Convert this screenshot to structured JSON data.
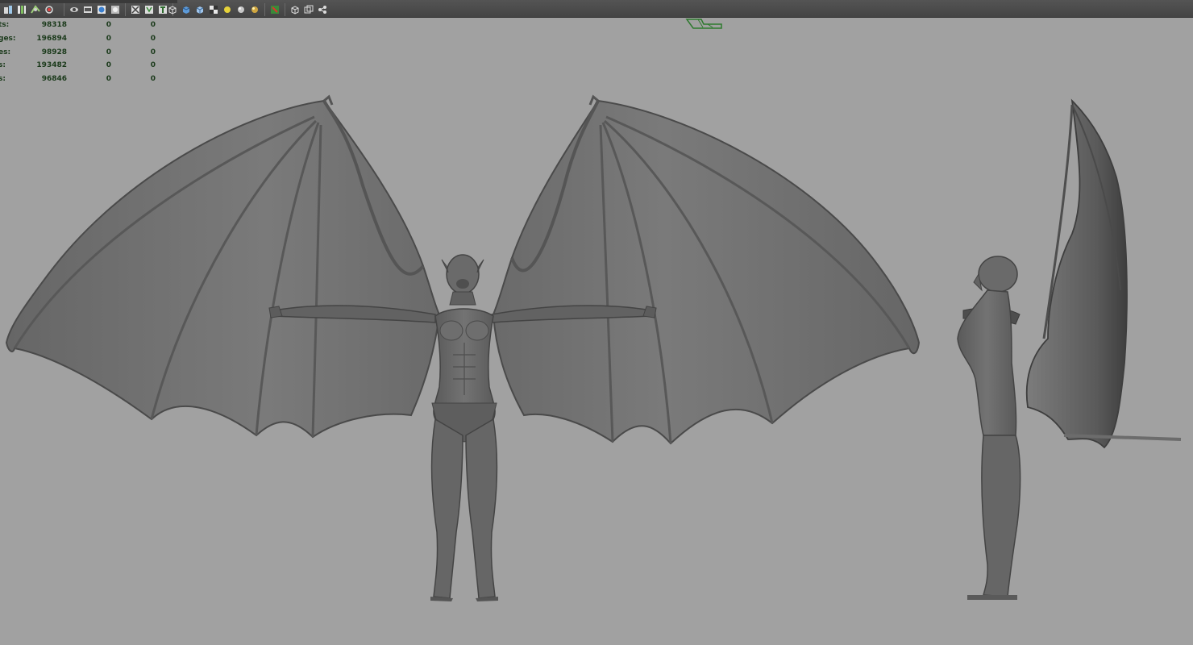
{
  "app": {
    "window": "Maya viewport"
  },
  "toolbar": {
    "icons": [
      "select-by-hierarchy-icon",
      "snap-grid-icon",
      "snap-curve-icon",
      "snap-point-icon",
      "camera-attributes-icon",
      "image-plane-icon",
      "grid-icon",
      "isolate-select-icon",
      "xray-icon",
      "wireframe-on-shaded-icon",
      "texture-icon",
      "wireframe-mode-icon",
      "smooth-shade-icon",
      "shade-default-icon",
      "use-all-lights-icon",
      "shadows-icon",
      "default-material-icon",
      "high-quality-icon",
      "render-view-icon",
      "ipr-icon",
      "hypershade-icon"
    ]
  },
  "hud": {
    "rows": [
      {
        "label": "ts:",
        "v1": "98318",
        "v2": "0",
        "v3": "0"
      },
      {
        "label": "ges:",
        "v1": "196894",
        "v2": "0",
        "v3": "0"
      },
      {
        "label": "es:",
        "v1": "98928",
        "v2": "0",
        "v3": "0"
      },
      {
        "label": "s:",
        "v1": "193482",
        "v2": "0",
        "v3": "0"
      },
      {
        "label": "s:",
        "v1": "96846",
        "v2": "0",
        "v3": "0"
      }
    ]
  },
  "colors": {
    "viewport_bg": "#a1a1a1",
    "toolbar_bg": "#4a4a4a",
    "model": "#6e6e6e",
    "model_dark": "#4a4a4a",
    "hud_text": "#1b3a1b",
    "camera_gizmo": "#2e7a2e"
  }
}
